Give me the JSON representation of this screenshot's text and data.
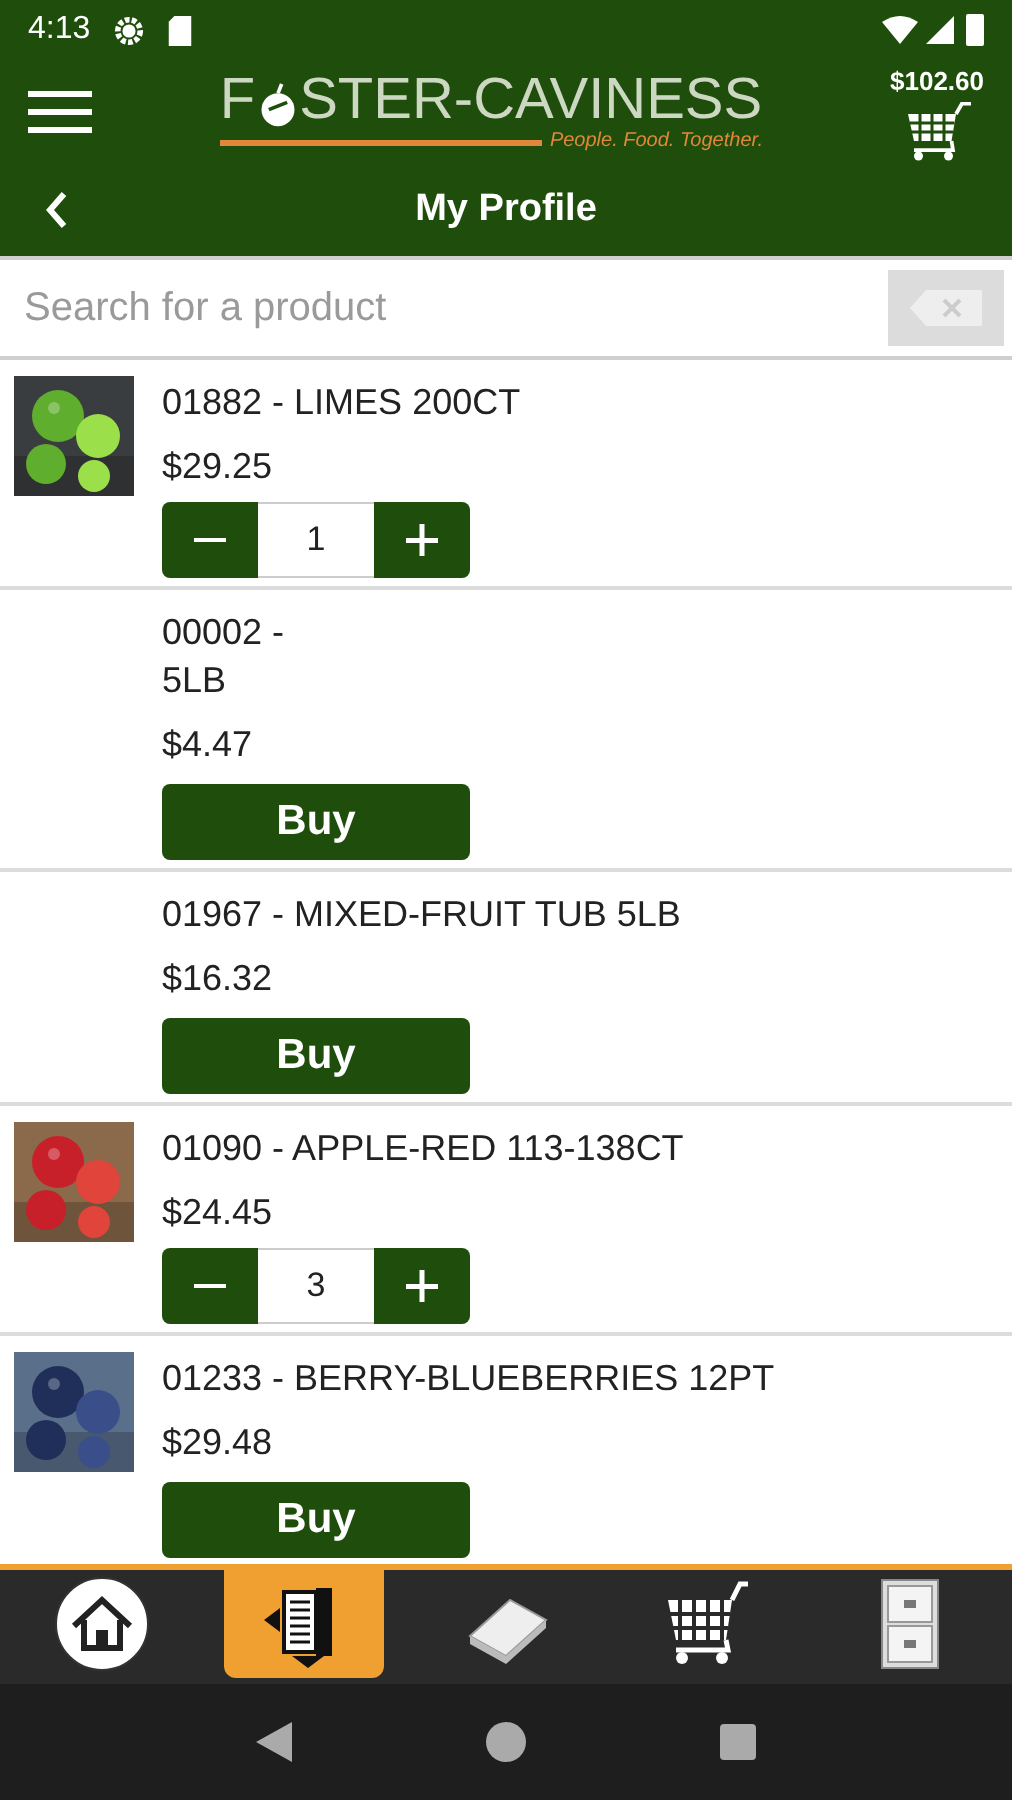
{
  "status_bar": {
    "time": "4:13"
  },
  "header": {
    "logo": {
      "start": "F",
      "end": "STER-CAVINESS",
      "tagline": "People. Food. Together."
    },
    "cart_total": "$102.60"
  },
  "title_bar": {
    "title": "My Profile"
  },
  "search": {
    "placeholder": "Search for a product"
  },
  "products": [
    {
      "title": "01882 - LIMES 200CT",
      "price": "$29.25",
      "kind": "stepper",
      "quantity": "1",
      "picture": true
    },
    {
      "title": "00002 -\n5LB",
      "price": "$4.47",
      "kind": "buy",
      "button": "Buy"
    },
    {
      "title": "01967 - MIXED-FRUIT TUB 5LB",
      "price": "$16.32",
      "kind": "buy",
      "button": "Buy"
    },
    {
      "title": "01090 - APPLE-RED 113-138CT",
      "price": "$24.45",
      "kind": "stepper",
      "quantity": "3",
      "picture": true
    },
    {
      "title": "01233 - BERRY-BLUEBERRIES 12PT",
      "price": "$29.48",
      "kind": "buy",
      "button": "Buy",
      "picture": true
    }
  ],
  "bottom_nav": [
    {
      "selected": false
    },
    {
      "selected": true
    },
    {
      "selected": false
    },
    {
      "selected": false
    },
    {
      "selected": false
    }
  ]
}
